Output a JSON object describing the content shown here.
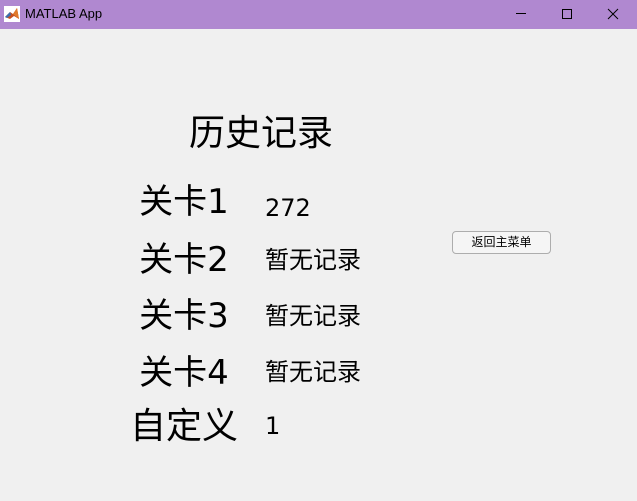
{
  "window": {
    "title": "MATLAB App",
    "icon": "matlab-logo-icon",
    "controls": [
      "minimize-icon",
      "maximize-icon",
      "close-icon"
    ],
    "titlebar_color": "#b088d0"
  },
  "page": {
    "heading": "历史记录",
    "records": [
      {
        "label": "关卡1",
        "value": "272"
      },
      {
        "label": "关卡2",
        "value": "暂无记录"
      },
      {
        "label": "关卡3",
        "value": "暂无记录"
      },
      {
        "label": "关卡4",
        "value": "暂无记录"
      },
      {
        "label": "自定义",
        "value": "1"
      }
    ],
    "back_button_label": "返回主菜单"
  }
}
